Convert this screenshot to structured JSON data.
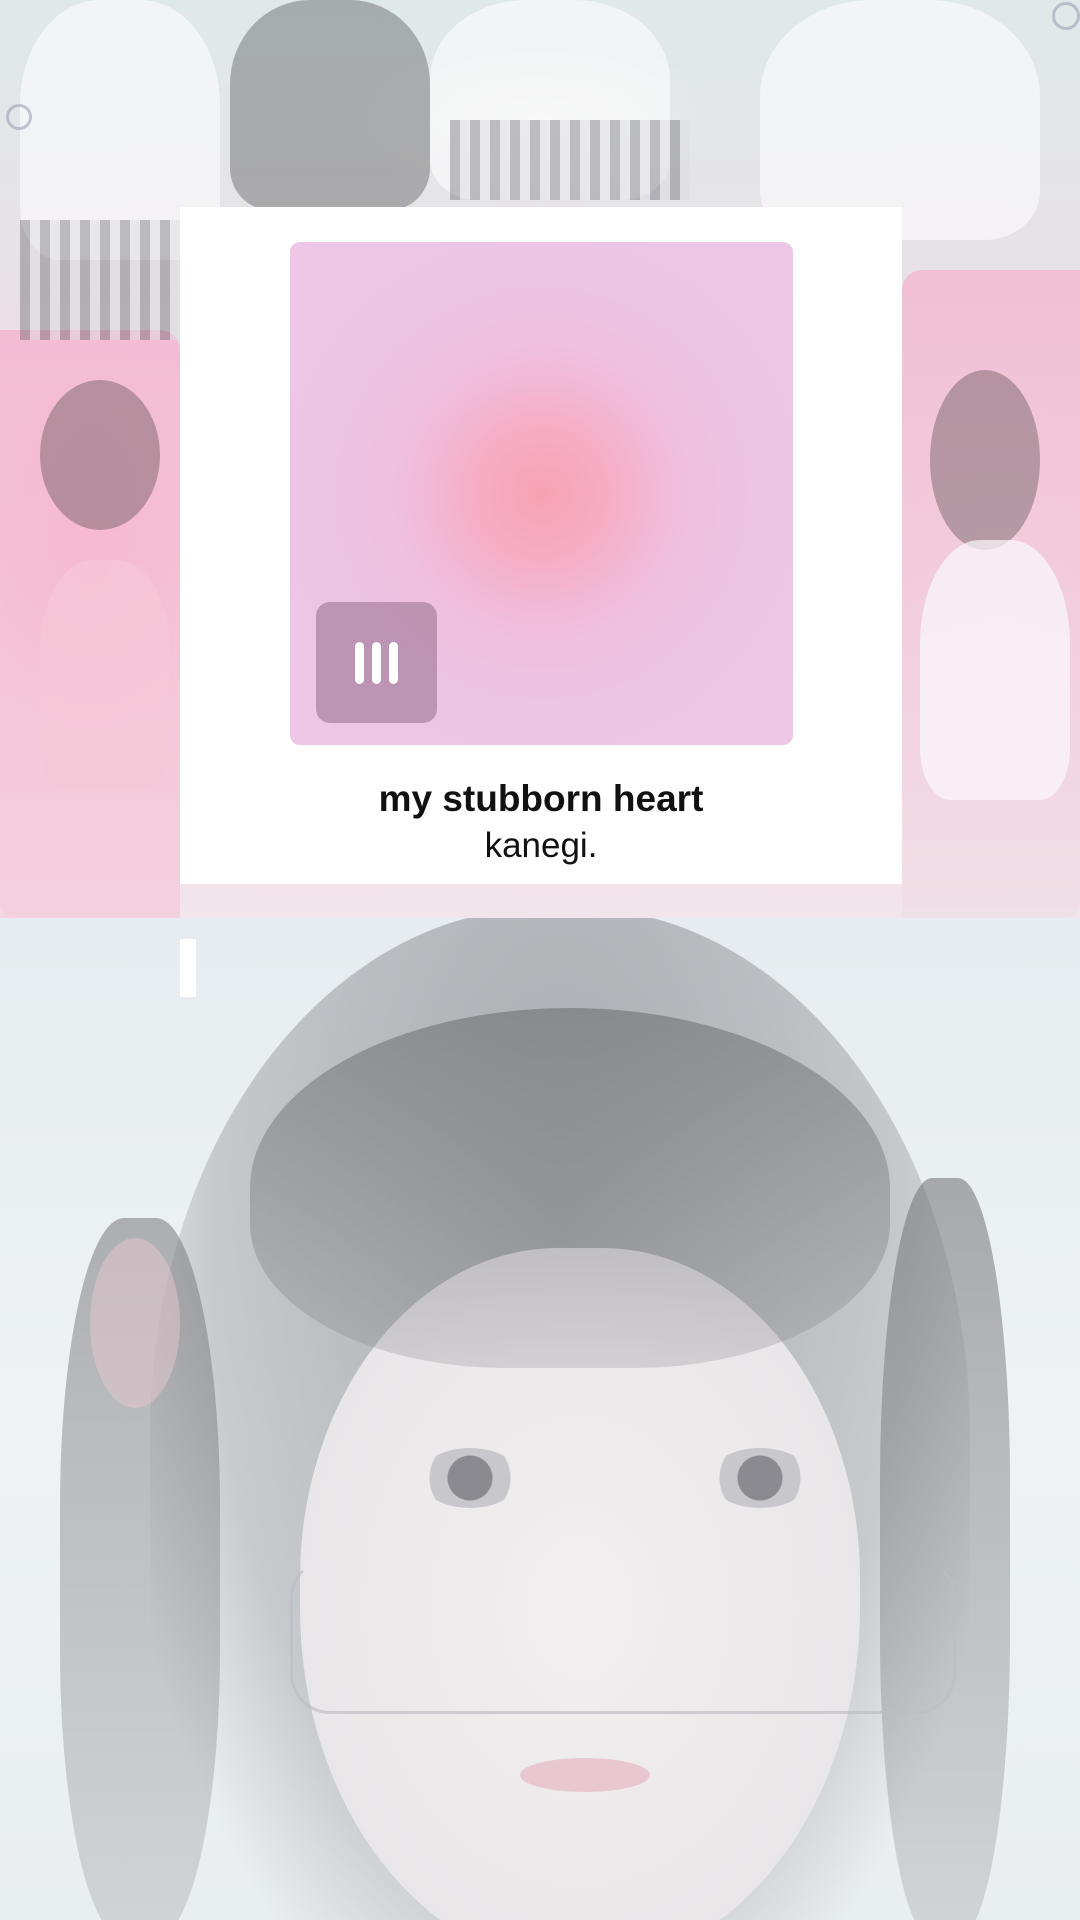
{
  "now_playing": {
    "title": "my stubborn heart",
    "artist": "kanegi.",
    "state": "playing",
    "icon": "equalizer-bars-icon"
  },
  "colors": {
    "card_background": "#ffffff",
    "album_glow_center": "#f7a2b3",
    "album_base": "#eec6e6",
    "playing_button": "#9a6e8c",
    "text": "#111111"
  }
}
